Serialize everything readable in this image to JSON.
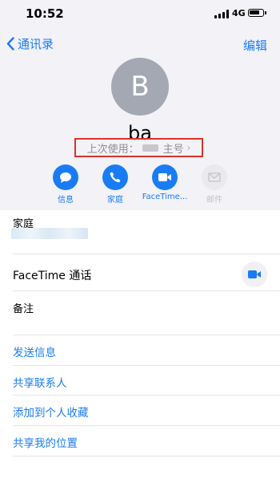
{
  "status_bar": {
    "time": "10:52",
    "network": "4G"
  },
  "nav": {
    "back_label": "通讯录",
    "edit_label": "编辑"
  },
  "contact": {
    "avatar_initial": "B",
    "name": "ba"
  },
  "last_used": {
    "prefix": "上次使用：",
    "line": "主号"
  },
  "actions": [
    {
      "label": "信息",
      "icon": "message-icon",
      "enabled": true
    },
    {
      "label": "家庭",
      "icon": "phone-icon",
      "enabled": true
    },
    {
      "label": "FaceTime...",
      "icon": "video-icon",
      "enabled": true
    },
    {
      "label": "邮件",
      "icon": "mail-icon",
      "enabled": false
    }
  ],
  "fields": {
    "phone_label": "家庭",
    "facetime_label": "FaceTime 通话",
    "notes_label": "备注"
  },
  "links": [
    "发送信息",
    "共享联系人",
    "添加到个人收藏",
    "共享我的位置"
  ],
  "colors": {
    "accent": "#1a7cf5",
    "header_bg": "#f2f2f7",
    "highlight_box": "#d9342b",
    "avatar_bg": "#a3a8b2"
  }
}
